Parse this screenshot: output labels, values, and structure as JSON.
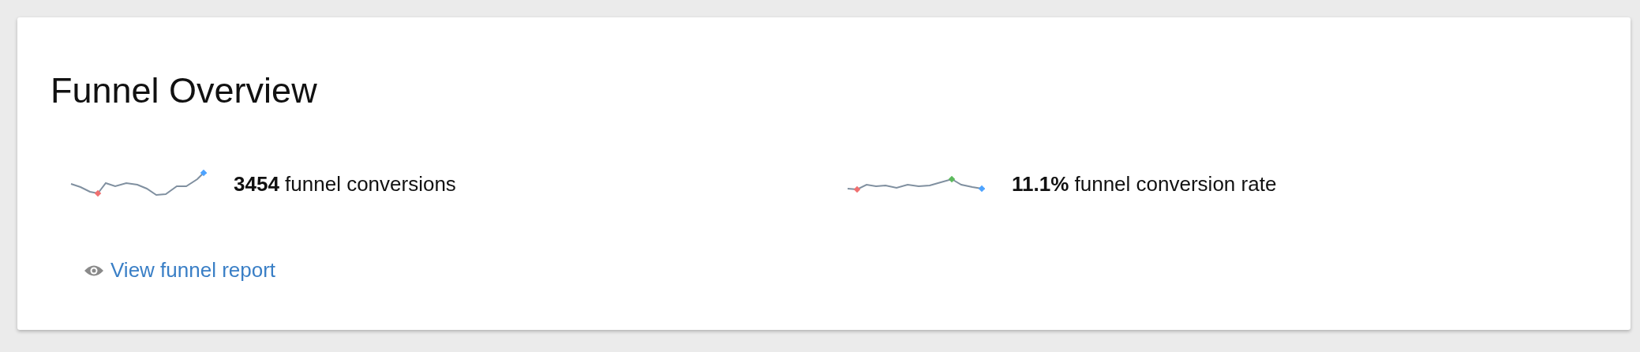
{
  "card": {
    "title": "Funnel Overview",
    "metrics": [
      {
        "text": "**3454** funnel conversions",
        "kind": "sparkline"
      },
      {
        "text": "**11.1%** funnel conversion rate",
        "kind": "sparkline"
      }
    ],
    "link": {
      "label": "View funnel report"
    }
  }
}
